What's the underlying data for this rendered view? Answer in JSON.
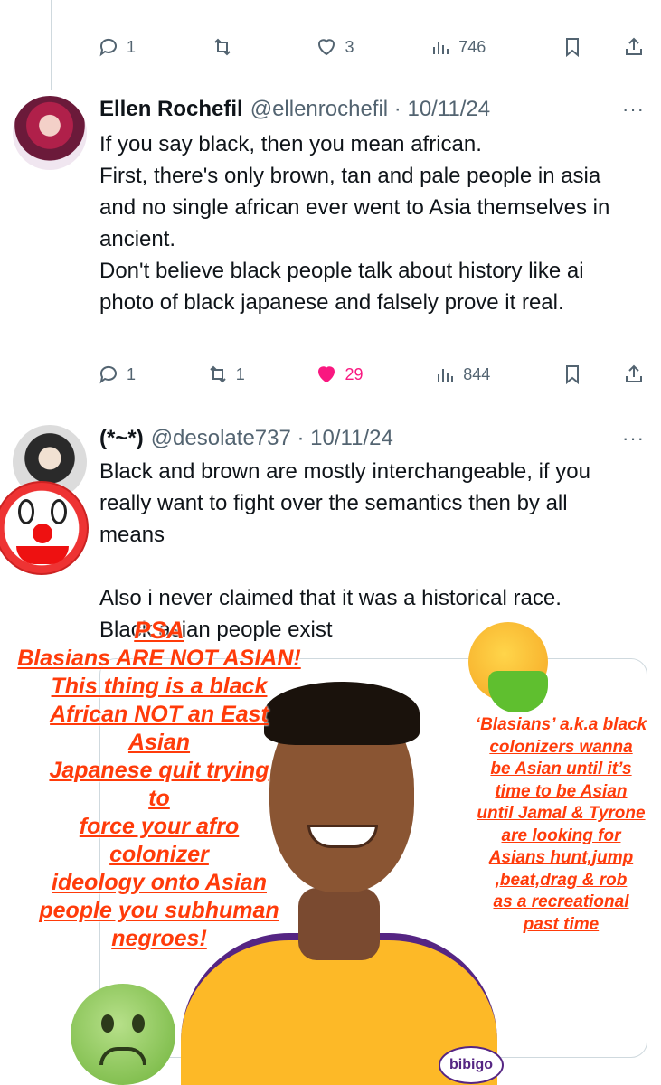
{
  "top_actions": {
    "reply_count": "1",
    "retweet_count": "",
    "like_count": "3",
    "view_count": "746"
  },
  "tweet1": {
    "name": "Ellen Rochefil",
    "handle": "@ellenrochefil · 10/11/24",
    "more": "···",
    "text": "If you say black, then you mean african.\nFirst, there's only brown, tan and pale people in asia and no single african ever went to Asia themselves in ancient.\nDon't believe black people talk about history like ai photo of black japanese and falsely prove it real.",
    "reply_count": "1",
    "retweet_count": "1",
    "like_count": "29",
    "view_count": "844"
  },
  "tweet2": {
    "name": "(*~*)",
    "handle": "@desolate737 · 10/11/24",
    "more": "···",
    "text": "Black and brown are mostly interchangeable, if you really want to fight over the semantics then by all means\n\nAlso i never claimed that it was a historical race.\nBlack asian people exist"
  },
  "overlay": {
    "psa_title": "PSA",
    "psa_lines": [
      "Blasians ARE NOT ASIAN!",
      "This thing is a black",
      "African NOT an East",
      "Asian",
      "Japanese quit trying",
      "to",
      "force your afro",
      "colonizer",
      "ideology onto Asian",
      "people you subhuman",
      "negroes!"
    ],
    "right_lines": [
      "‘Blasians’ a.k.a black",
      "colonizers wanna",
      "be Asian until it’s",
      "time to be Asian",
      "until Jamal & Tyrone",
      "are looking for",
      "Asians hunt,jump",
      ",beat,drag & rob",
      "as a recreational",
      "past time"
    ],
    "jersey_badge": "bibigo"
  },
  "colors": {
    "like_active": "#f91880",
    "overlay_text": "#ff3b0a",
    "muted": "#536471"
  }
}
